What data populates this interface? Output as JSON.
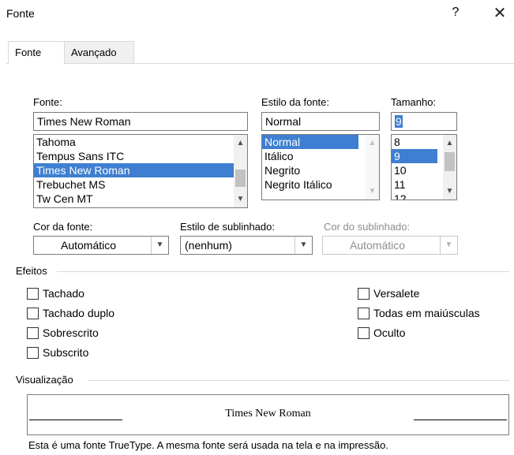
{
  "window": {
    "title": "Fonte",
    "help_label": "?",
    "close_label": "✕"
  },
  "tabs": [
    {
      "label": "Fonte",
      "active": true
    },
    {
      "label": "Avançado",
      "active": false
    }
  ],
  "font": {
    "label": "Fonte:",
    "value": "Times New Roman",
    "list": [
      "Tahoma",
      "Tempus Sans ITC",
      "Times New Roman",
      "Trebuchet MS",
      "Tw Cen MT"
    ],
    "selected": "Times New Roman"
  },
  "style": {
    "label": "Estilo da fonte:",
    "value": "Normal",
    "list": [
      "Normal",
      "Itálico",
      "Negrito",
      "Negrito Itálico"
    ],
    "selected": "Normal"
  },
  "size": {
    "label": "Tamanho:",
    "value": "9",
    "list": [
      "8",
      "9",
      "10",
      "11",
      "12"
    ],
    "selected": "9"
  },
  "font_color": {
    "label": "Cor da fonte:",
    "value": "Automático"
  },
  "underline_style": {
    "label": "Estilo de sublinhado:",
    "value": "(nenhum)"
  },
  "underline_color": {
    "label": "Cor do sublinhado:",
    "value": "Automático",
    "disabled": true
  },
  "effects": {
    "label": "Efeitos",
    "left": [
      "Tachado",
      "Tachado duplo",
      "Sobrescrito",
      "Subscrito"
    ],
    "right": [
      "Versalete",
      "Todas em maiúsculas",
      "Oculto"
    ]
  },
  "preview": {
    "label": "Visualização",
    "sample": "Times New Roman",
    "note": "Esta é uma fonte TrueType. A mesma fonte será usada na tela e na impressão."
  },
  "icons": {
    "scroll_up": "▲",
    "scroll_down": "▼",
    "dropdown": "▼"
  }
}
